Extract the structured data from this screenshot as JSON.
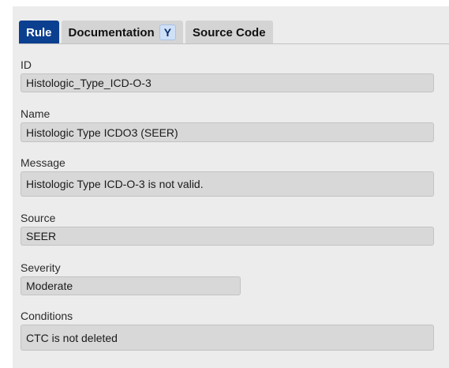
{
  "tabs": {
    "rule": "Rule",
    "documentation": "Documentation",
    "documentation_badge": "Y",
    "source_code": "Source Code"
  },
  "fields": {
    "id": {
      "label": "ID",
      "value": "Histologic_Type_ICD-O-3"
    },
    "name": {
      "label": "Name",
      "value": "Histologic Type ICDO3 (SEER)"
    },
    "message": {
      "label": "Message",
      "value": "Histologic Type ICD-O-3 is not valid."
    },
    "source": {
      "label": "Source",
      "value": "SEER"
    },
    "severity": {
      "label": "Severity",
      "value": "Moderate"
    },
    "conditions": {
      "label": "Conditions",
      "value": "CTC is not deleted"
    }
  },
  "colors": {
    "active_tab": "#0b3f8f",
    "panel_bg": "#ececec",
    "field_bg": "#d8d8d8"
  }
}
